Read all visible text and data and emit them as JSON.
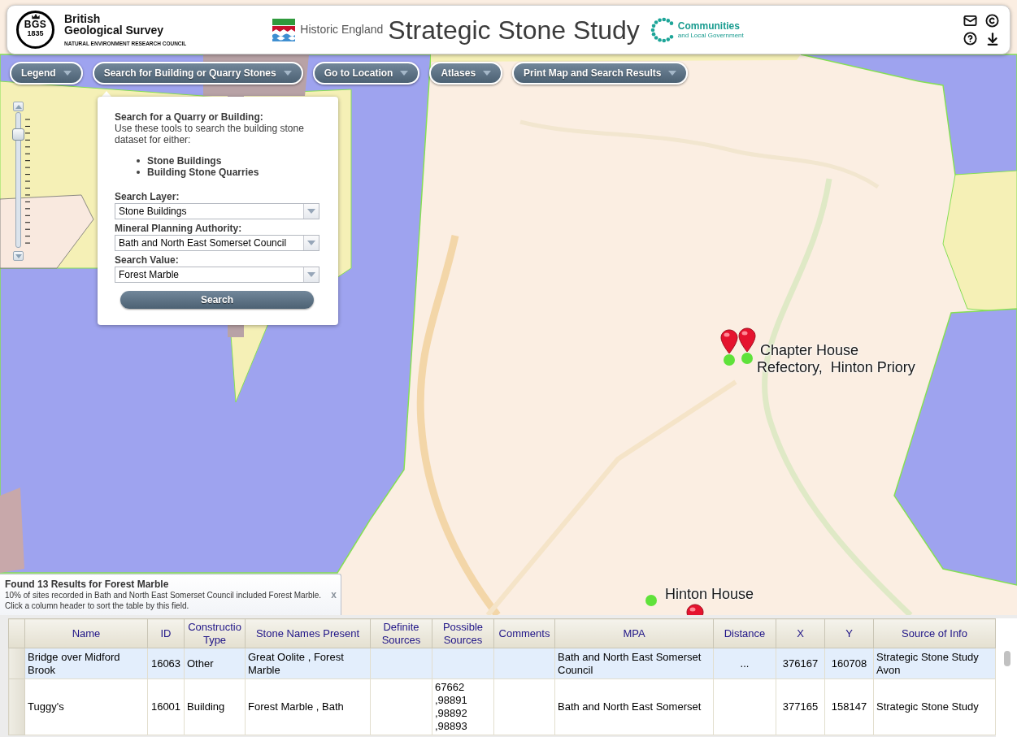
{
  "header": {
    "logo_initials": "BGS",
    "logo_year": "1835",
    "org_name": "British\nGeological Survey",
    "org_subtitle": "NATURAL ENVIRONMENT RESEARCH COUNCIL",
    "partner": "Historic England",
    "title": "Strategic Stone Study",
    "partner_2": {
      "name": "Communities",
      "subtitle": "and Local Government"
    }
  },
  "nav": [
    {
      "label": "Legend"
    },
    {
      "label": "Search for Building or Quarry Stones"
    },
    {
      "label": "Go to Location"
    },
    {
      "label": "Atlases"
    },
    {
      "label": "Print Map and Search Results"
    }
  ],
  "zoom_slider": {
    "level": 0.87
  },
  "search_panel": {
    "heading": "Search for a Quarry or Building:",
    "description": "Use these tools to search the building stone dataset for either:",
    "options": [
      "Stone Buildings",
      "Building Stone Quarries"
    ],
    "fields": [
      {
        "label": "Search Layer:",
        "value": "Stone Buildings"
      },
      {
        "label": "Mineral Planning Authority:",
        "value": "Bath and North East Somerset Council"
      },
      {
        "label": "Search Value:",
        "value": "Forest Marble"
      }
    ],
    "button": "Search"
  },
  "map": {
    "labels": [
      {
        "text": "Chapter House Refectory,  Hinton Priory"
      },
      {
        "text": "Hinton House"
      }
    ]
  },
  "results": {
    "title": "Found 13 Results for Forest Marble",
    "summary": "10% of sites recorded in Bath and North East Somerset Council included Forest Marble.",
    "hint": "Click a column header to sort the table by this field.",
    "close": "x"
  },
  "table": {
    "columns": [
      "Name",
      "ID",
      "Constructio Type",
      "Stone Names Present",
      "Definite Sources",
      "Possible Sources",
      "Comments",
      "MPA",
      "Distance",
      "X",
      "Y",
      "Source of Info"
    ],
    "rows": [
      {
        "selected": true,
        "cells": [
          "Bridge over Midford Brook",
          "16063",
          "Other",
          "Great Oolite , Forest Marble",
          null,
          null,
          null,
          "Bath and North East Somerset Council",
          "...",
          "376167",
          "160708",
          "Strategic Stone Study Avon"
        ]
      },
      {
        "selected": false,
        "cells": [
          "Tuggy's",
          "16001",
          "Building",
          "Forest Marble , Bath",
          null,
          "67662 ,98891 ,98892 ,98893",
          null,
          "Bath and North East Somerset",
          null,
          "377165",
          "158147",
          "Strategic Stone Study"
        ]
      }
    ]
  }
}
